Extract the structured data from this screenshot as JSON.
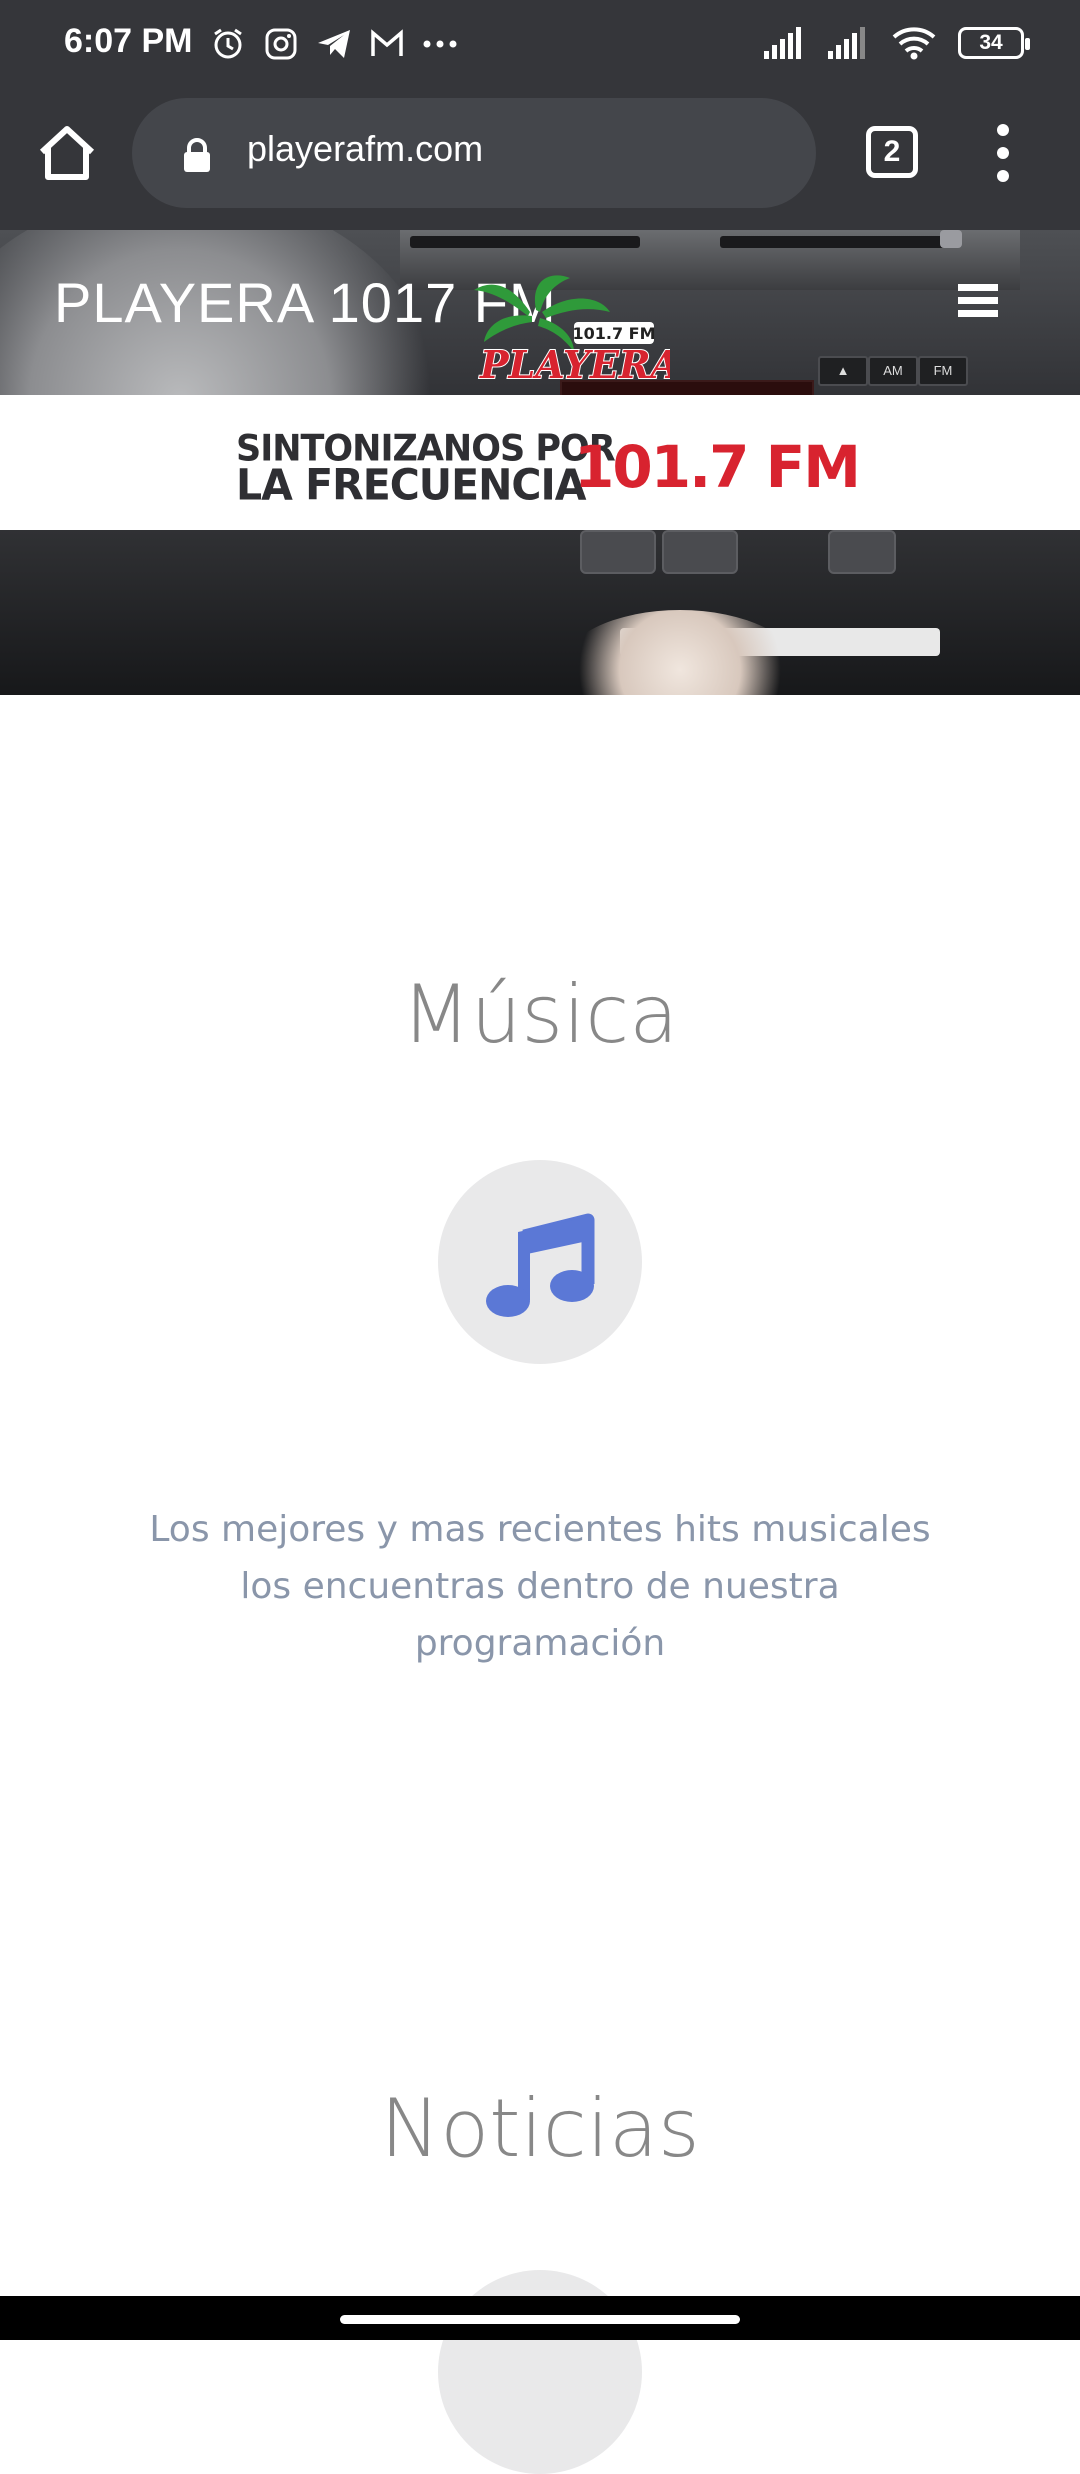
{
  "status_bar": {
    "time": "6:07 PM",
    "battery": "34",
    "left_icons": [
      "alarm-icon",
      "instagram-icon",
      "telegram-icon",
      "gmail-icon",
      "more-dots-icon"
    ],
    "right_icons": [
      "signal-icon",
      "signal-icon",
      "wifi-icon",
      "battery-icon"
    ]
  },
  "browser": {
    "url": "playerafm.com",
    "tab_count": "2"
  },
  "site": {
    "brand": "PLAYERA 1017 FM",
    "logo_freq": "101.7 FM",
    "logo_name": "PLAYERA",
    "banner_line1": "SINTONIZANOS POR",
    "banner_line2": "LA FRECUENCIA",
    "banner_freq": "101.7 FM"
  },
  "sections": {
    "musica": {
      "title": "Música",
      "icon": "music-note-icon",
      "description": "Los mejores y mas recientes hits musicales los encuentras dentro de nuestra programación"
    },
    "noticias": {
      "title": "Noticias"
    }
  },
  "colors": {
    "accent_icon": "#5b78d6",
    "banner_red": "#d8232f",
    "chrome": "#35363a"
  }
}
